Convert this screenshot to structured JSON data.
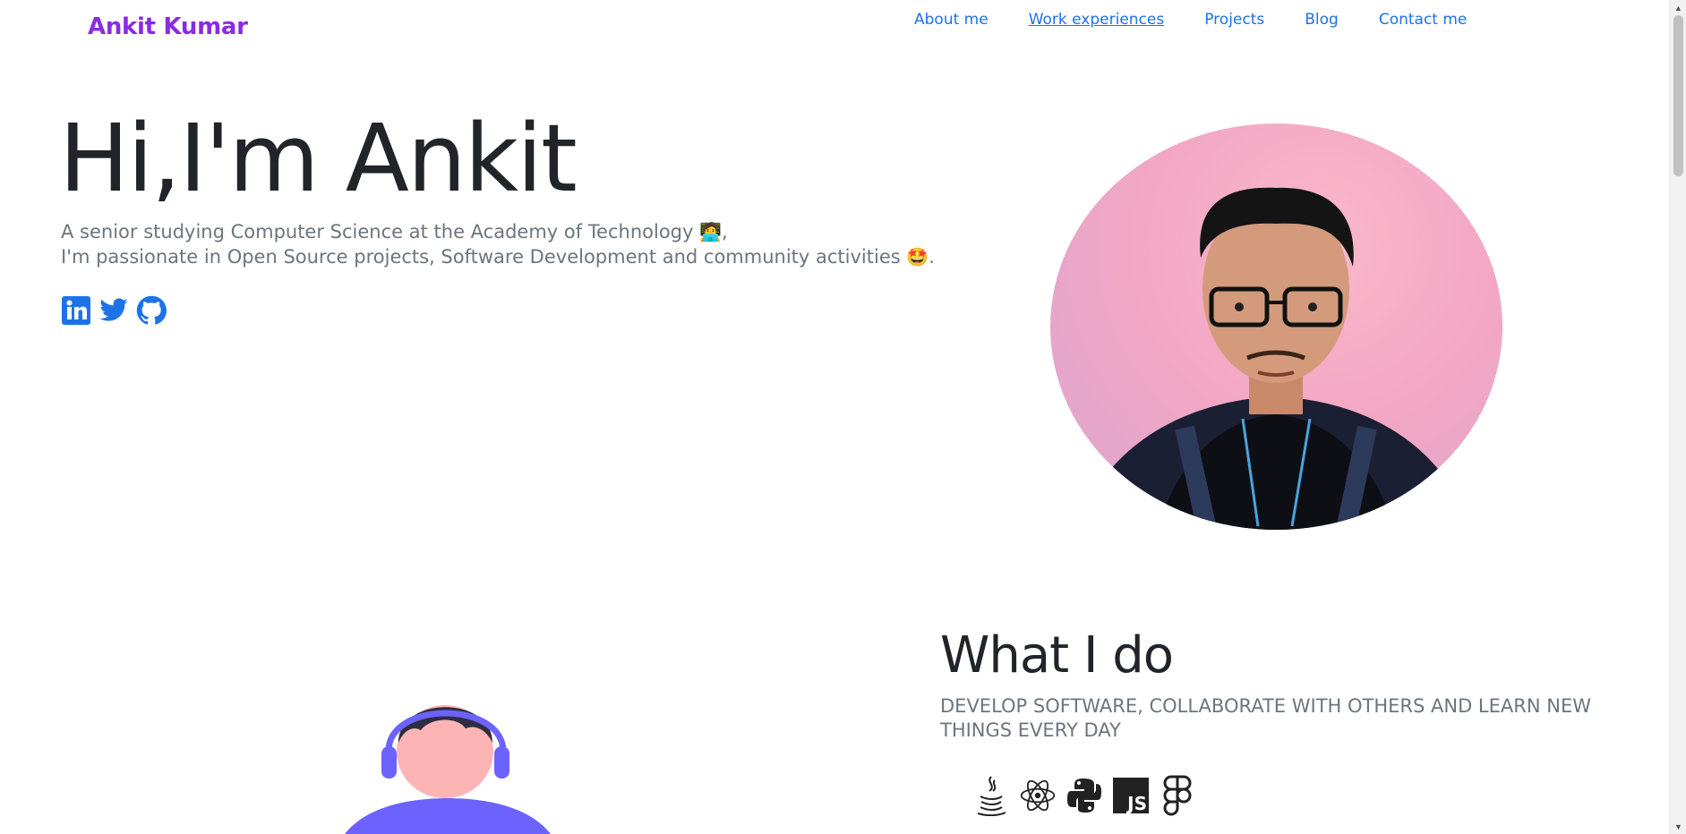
{
  "brand": "Ankit Kumar",
  "nav": {
    "items": [
      "About me",
      "Work experiences",
      "Projects",
      "Blog",
      "Contact me"
    ],
    "active_index": 1
  },
  "hero": {
    "title": "Hi,I'm Ankit",
    "line1": "A senior studying Computer Science at the Academy of Technology",
    "line1_emoji": "🧑‍💻",
    "line1_end": ",",
    "line2": "I'm passionate in Open Source projects, Software Development and community activities",
    "line2_emoji": "🤩",
    "line2_end": "."
  },
  "socials": [
    {
      "icon": "linkedin-icon"
    },
    {
      "icon": "twitter-icon"
    },
    {
      "icon": "github-icon"
    }
  ],
  "what_i_do": {
    "title": "What I do",
    "subtitle": "DEVELOP SOFTWARE, COLLABORATE WITH OTHERS AND LEARN NEW THINGS EVERY DAY",
    "skills": [
      {
        "icon": "java-icon"
      },
      {
        "icon": "react-icon"
      },
      {
        "icon": "python-icon"
      },
      {
        "icon": "javascript-icon",
        "label": "JS"
      },
      {
        "icon": "figma-icon"
      }
    ]
  },
  "colors": {
    "brand": "#8a2be2",
    "link": "#1d72e8",
    "social": "#1d72e8",
    "heading": "#212529",
    "muted": "#6c757d",
    "avatar_bg": "#f3a7c3",
    "illustration": "#6c63ff"
  }
}
